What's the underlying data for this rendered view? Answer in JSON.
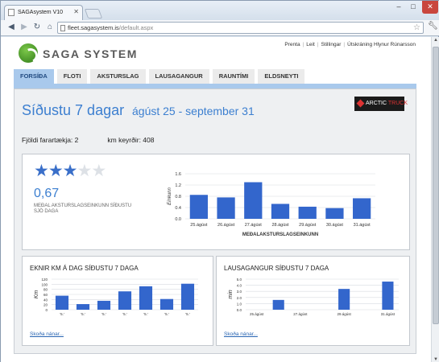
{
  "browser": {
    "tab_title": "SAGAsystem V10",
    "url_host": "fleet.sagasystem.is",
    "url_path": "/default.aspx"
  },
  "logo": {
    "text": "SAGA SYSTEM"
  },
  "toplinks": [
    "Prenta",
    "Leit",
    "Stillingar",
    "Útskráning Hlynur Rúnarsson"
  ],
  "nav": [
    "FORSÍÐA",
    "FLOTI",
    "AKSTURSLAG",
    "LAUSAGANGUR",
    "RAUNTÍMI",
    "ELDSNEYTI"
  ],
  "header": {
    "title": "Síðustu 7 dagar",
    "date_range": "ágúst 25 - september 31",
    "brand_a": "ARCTIC",
    "brand_b": "TRUCK"
  },
  "stats": {
    "vehicles": "Fjöldi farartækja: 2",
    "km": "km keyrðir:   408"
  },
  "rating": {
    "stars_filled": 3,
    "stars_total": 5,
    "score": "0,67",
    "caption": "MEÐAL AKSTURSLAGSEINKUNN SÍÐUSTU SJÖ DAGA"
  },
  "km_card": {
    "title": "EKNIR KM Á DAG SÍÐUSTU 7 DAGA",
    "more": "Skoða nánar..."
  },
  "idle_card": {
    "title": "LAUSAGANGUR SÍÐUSTU 7 DAGA",
    "more": "Skoða nánar..."
  },
  "colors": {
    "accent": "#3c7fd0",
    "bar": "#3366cc",
    "nav_active": "#a9c9ec"
  },
  "chart_data": [
    {
      "type": "bar",
      "categories": [
        "25.ágúst",
        "26.ágúst",
        "27.ágúst",
        "28.ágúst",
        "29.ágúst",
        "30.ágúst",
        "31.ágúst"
      ],
      "values": [
        0.85,
        0.76,
        1.3,
        0.53,
        0.43,
        0.38,
        0.73
      ],
      "xlabel": "MEÐALAKSTURSLAGSEINKUNN",
      "ylabel": "Einkunn",
      "ylim": [
        0,
        1.6
      ],
      "yticks": [
        "0.0",
        "0.4",
        "0.8",
        "1.2",
        "1.6"
      ],
      "grid": true
    },
    {
      "type": "bar",
      "categories": [
        "'5.'",
        "'5.'",
        "'5.'",
        "'5.'",
        "'5.'",
        "'5.'",
        "'5.'"
      ],
      "values": [
        55,
        22,
        35,
        72,
        92,
        42,
        102
      ],
      "ylabel": "Km",
      "ylim": [
        0,
        120
      ],
      "yticks": [
        "0",
        "20",
        "40",
        "60",
        "80",
        "100",
        "120"
      ],
      "grid": true
    },
    {
      "type": "bar",
      "categories": [
        "25.ágúst",
        "27.ágúst",
        "29.ágúst",
        "31.ágúst"
      ],
      "values": [
        0,
        1.6,
        0,
        0,
        3.4,
        0,
        4.6
      ],
      "ylabel": "min",
      "ylim": [
        0,
        5
      ],
      "yticks": [
        "0.0",
        "1.0",
        "2.0",
        "3.0",
        "4.0",
        "5.0"
      ],
      "grid": true
    }
  ]
}
